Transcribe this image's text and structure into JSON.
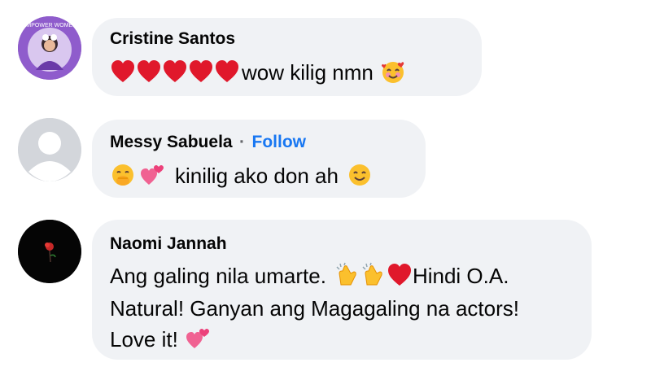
{
  "comments": [
    {
      "author": "Cristine Santos",
      "avatar_icon": "empower-women-avatar",
      "avatar_ring_text": "EMPOWER WOMEN",
      "text": "wow kilig nmn",
      "leading_emojis": [
        "red-heart",
        "red-heart",
        "red-heart",
        "red-heart",
        "red-heart"
      ],
      "trailing_emojis": [
        "smiling-face-with-hearts"
      ]
    },
    {
      "author": "Messy Sabuela",
      "separator": "·",
      "follow_label": "Follow",
      "avatar_icon": "default-profile-avatar",
      "text": "kinilig ako don ah",
      "leading_emojis": [
        "hand-over-mouth",
        "two-hearts"
      ],
      "trailing_emojis": [
        "smiling-face"
      ]
    },
    {
      "author": "Naomi Jannah",
      "avatar_icon": "rose-avatar",
      "line1": "Ang galing nila umarte.",
      "line1_emojis": [
        "clapping-hands",
        "clapping-hands",
        "red-heart"
      ],
      "line1_tail": "Hindi O.A.",
      "line2": "Natural! Ganyan ang Magagaling na actors!",
      "line3": "Love it!",
      "line3_emojis": [
        "two-hearts"
      ]
    }
  ],
  "colors": {
    "bubble": "#f0f2f5",
    "follow": "#1877f2",
    "text": "#050505",
    "avatar_ring": "#7b4bb7",
    "heart": "#e0182b"
  }
}
